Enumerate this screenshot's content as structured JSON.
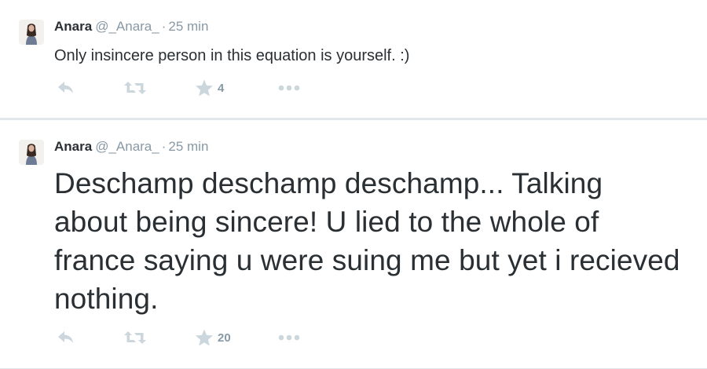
{
  "tweets": [
    {
      "name": "Anara",
      "handle": "@_Anara_",
      "separator": "·",
      "time": "25 min",
      "text": "Only insincere person in this equation is yourself. :)",
      "favorites": "4"
    },
    {
      "name": "Anara",
      "handle": "@_Anara_",
      "separator": "·",
      "time": "25 min",
      "text": "Deschamp deschamp deschamp... Talking about being sincere! U lied to the whole of france saying u were suing me but yet i recieved nothing.",
      "favorites": "20"
    }
  ],
  "icons": {
    "reply": "reply-icon",
    "retweet": "retweet-icon",
    "favorite": "star-icon",
    "more": "more-dots-icon",
    "avatar": "avatar"
  },
  "colors": {
    "background": "#e1e8ed",
    "card": "#ffffff",
    "text": "#292f33",
    "muted": "#8899a6",
    "icon": "#ccd6dd"
  }
}
